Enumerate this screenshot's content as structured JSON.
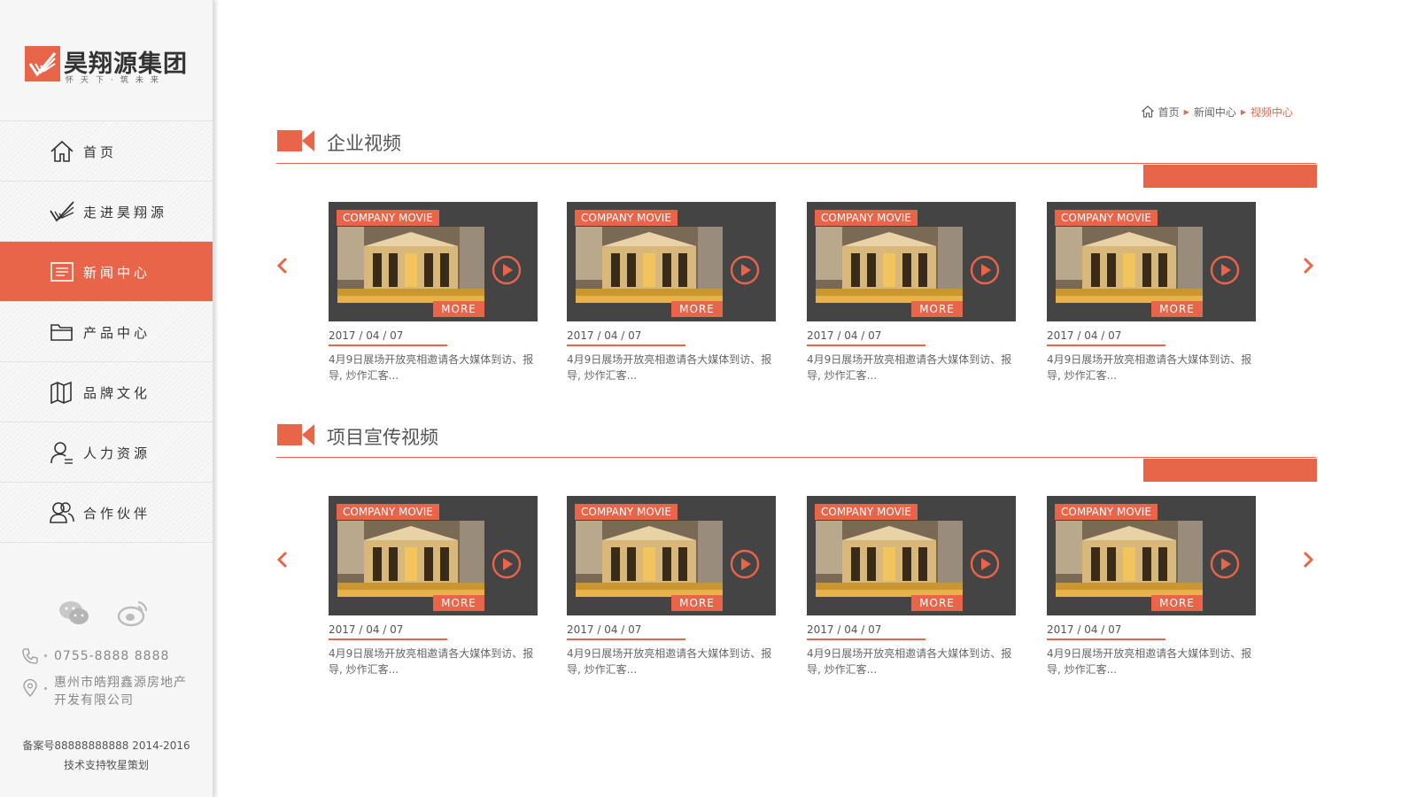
{
  "brand": {
    "name": "昊翔源集团",
    "slogan": "怀天下·筑未来",
    "accent_color": "#e8654a"
  },
  "nav": {
    "items": [
      {
        "label": "首页",
        "icon": "home-icon",
        "active": false
      },
      {
        "label": "走进昊翔源",
        "icon": "logo-mark-icon",
        "active": false
      },
      {
        "label": "新闻中心",
        "icon": "news-icon",
        "active": true
      },
      {
        "label": "产品中心",
        "icon": "folder-icon",
        "active": false
      },
      {
        "label": "品牌文化",
        "icon": "map-icon",
        "active": false
      },
      {
        "label": "人力资源",
        "icon": "user-icon",
        "active": false
      },
      {
        "label": "合作伙伴",
        "icon": "partners-icon",
        "active": false
      }
    ]
  },
  "social": {
    "icons": [
      "wechat-icon",
      "weibo-icon"
    ]
  },
  "contact": {
    "phone": "0755-8888 8888",
    "address_line1": "惠州市皓翔鑫源房地产",
    "address_line2": "开发有限公司"
  },
  "footer": {
    "icp": "备案号88888888888 2014-2016",
    "support": "技术支持牧星策划"
  },
  "breadcrumb": {
    "home": "首页",
    "parent": "新闻中心",
    "current": "视频中心"
  },
  "sections": [
    {
      "title": "企业视频",
      "cards": [
        {
          "label": "COMPANY MOVIE",
          "more": "MORE",
          "date": "2017 / 04 / 07",
          "desc": "4月9日展场开放亮相邀请各大媒体到访、报导, 炒作汇客..."
        },
        {
          "label": "COMPANY MOVIE",
          "more": "MORE",
          "date": "2017 / 04 / 07",
          "desc": "4月9日展场开放亮相邀请各大媒体到访、报导, 炒作汇客..."
        },
        {
          "label": "COMPANY MOVIE",
          "more": "MORE",
          "date": "2017 / 04 / 07",
          "desc": "4月9日展场开放亮相邀请各大媒体到访、报导, 炒作汇客..."
        },
        {
          "label": "COMPANY MOVIE",
          "more": "MORE",
          "date": "2017 / 04 / 07",
          "desc": "4月9日展场开放亮相邀请各大媒体到访、报导, 炒作汇客..."
        }
      ]
    },
    {
      "title": "项目宣传视频",
      "cards": [
        {
          "label": "COMPANY MOVIE",
          "more": "MORE",
          "date": "2017 / 04 / 07",
          "desc": "4月9日展场开放亮相邀请各大媒体到访、报导, 炒作汇客..."
        },
        {
          "label": "COMPANY MOVIE",
          "more": "MORE",
          "date": "2017 / 04 / 07",
          "desc": "4月9日展场开放亮相邀请各大媒体到访、报导, 炒作汇客..."
        },
        {
          "label": "COMPANY MOVIE",
          "more": "MORE",
          "date": "2017 / 04 / 07",
          "desc": "4月9日展场开放亮相邀请各大媒体到访、报导, 炒作汇客..."
        },
        {
          "label": "COMPANY MOVIE",
          "more": "MORE",
          "date": "2017 / 04 / 07",
          "desc": "4月9日展场开放亮相邀请各大媒体到访、报导, 炒作汇客..."
        }
      ]
    }
  ]
}
